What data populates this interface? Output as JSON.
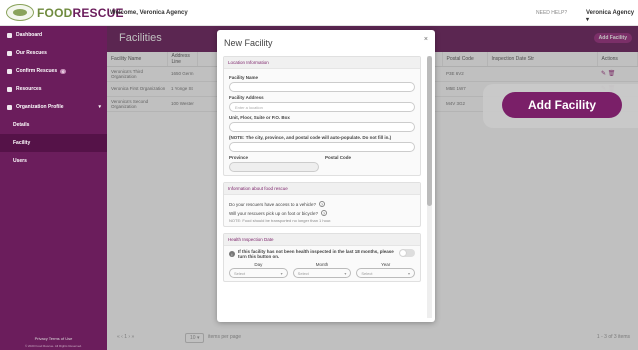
{
  "brand": {
    "name_a": "FOOD",
    "name_b": "RESCUE"
  },
  "header": {
    "welcome": "Welcome, Veronica Agency",
    "help": "NEED HELP?",
    "user": "Veronica Agency"
  },
  "sidebar": {
    "items": [
      {
        "label": "Dashboard"
      },
      {
        "label": "Our Rescues"
      },
      {
        "label": "Confirm Rescues",
        "badge": "0"
      },
      {
        "label": "Resources"
      },
      {
        "label": "Organization Profile"
      },
      {
        "label": "Details"
      },
      {
        "label": "Facility"
      },
      {
        "label": "Users"
      }
    ],
    "footer": "Privacy  Terms of Use",
    "footer2": "© 2020 Food Rescue. All Rights Reserved."
  },
  "page": {
    "title": "Facilities",
    "add_button": "Add Facility"
  },
  "table": {
    "columns": [
      "Facility Name",
      "Address Line",
      "Postal Code",
      "Inspection Date Str",
      "Actions"
    ],
    "rows": [
      {
        "name": "Veronica's Third Organization",
        "address": "1650 Germ",
        "postal": "P3E 6V2"
      },
      {
        "name": "Veronica First Organization",
        "address": "1 Yonge St",
        "postal": "M5E 1W7"
      },
      {
        "name": "Veronica's Second Organization",
        "address": "100 Wester",
        "postal": "M4V 3G2"
      }
    ]
  },
  "pager": {
    "nav": "«  ‹  1  ›  »",
    "per_page": "10",
    "per_page_label": "items per page",
    "count": "1 - 3 of 3 items"
  },
  "highlight": {
    "label": "Add Facility"
  },
  "modal": {
    "title": "New Facility",
    "close": "×",
    "location": {
      "header": "Location Information",
      "name_label": "Facility Name",
      "address_label": "Facility Address",
      "address_placeholder": "Enter a location",
      "unit_label": "Unit, Floor, Suite or P.O. Box",
      "note": "(NOTE: The city, province, and postal code will auto-populate. Do not fill in.)",
      "province_label": "Province",
      "postal_label": "Postal Code"
    },
    "about": {
      "header": "Information about food rescue",
      "q1": "Do your rescuers have access to a vehicle?",
      "q2": "Will your rescuers pick up on foot or bicycle?",
      "note": "NOTE: Food should be transported no longer than 1 hour."
    },
    "health": {
      "header": "Health Inspection Date",
      "text": "If this facility has not been health inspected in the last 18 months, please turn this button on.",
      "day": "Day",
      "month": "Month",
      "year": "Year",
      "select": "Select"
    }
  }
}
